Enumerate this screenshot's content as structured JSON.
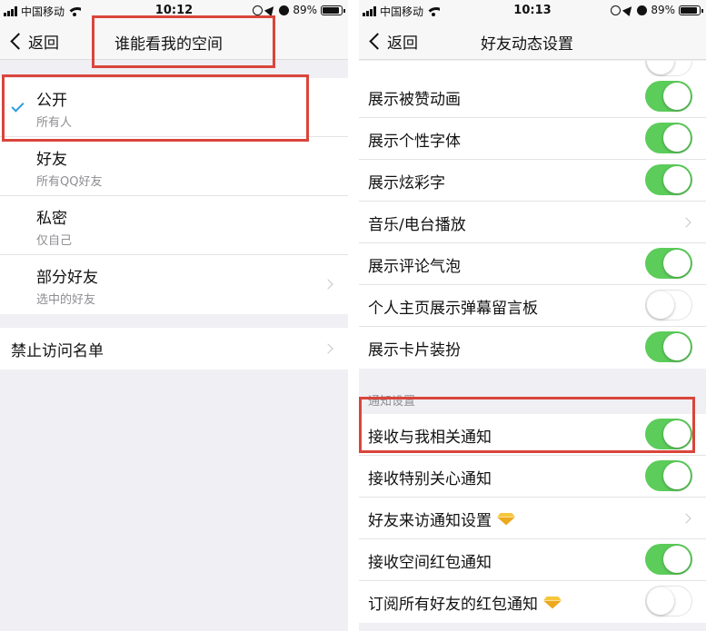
{
  "left_screen": {
    "status": {
      "carrier": "中国移动",
      "time": "10:12",
      "battery": "89%",
      "battery_level": 0.89
    },
    "nav": {
      "back_label": "返回",
      "title": "谁能看我的空间"
    },
    "options": [
      {
        "title": "公开",
        "subtitle": "所有人",
        "selected": true
      },
      {
        "title": "好友",
        "subtitle": "所有QQ好友",
        "selected": false
      },
      {
        "title": "私密",
        "subtitle": "仅自己",
        "selected": false
      },
      {
        "title": "部分好友",
        "subtitle": "选中的好友",
        "selected": false,
        "disclosure": true
      }
    ],
    "blocklist_label": "禁止访问名单"
  },
  "right_screen": {
    "status": {
      "carrier": "中国移动",
      "time": "10:13",
      "battery": "89%",
      "battery_level": 0.89
    },
    "nav": {
      "back_label": "返回",
      "title": "好友动态设置"
    },
    "rows": [
      {
        "label": "展示被赞动画",
        "control": "toggle",
        "on": true
      },
      {
        "label": "展示个性字体",
        "control": "toggle",
        "on": true
      },
      {
        "label": "展示炫彩字",
        "control": "toggle",
        "on": true
      },
      {
        "label": "音乐/电台播放",
        "control": "disclosure"
      },
      {
        "label": "展示评论气泡",
        "control": "toggle",
        "on": true
      },
      {
        "label": "个人主页展示弹幕留言板",
        "control": "toggle",
        "on": false
      },
      {
        "label": "展示卡片装扮",
        "control": "toggle",
        "on": true
      }
    ],
    "notify_section_header": "通知设置",
    "notify_rows": [
      {
        "label": "接收与我相关通知",
        "control": "toggle",
        "on": true
      },
      {
        "label": "接收特别关心通知",
        "control": "toggle",
        "on": true
      },
      {
        "label": "好友来访通知设置",
        "control": "disclosure",
        "badge": "diamond-icon"
      },
      {
        "label": "接收空间红包通知",
        "control": "toggle",
        "on": true
      },
      {
        "label": "订阅所有好友的红包通知",
        "control": "toggle",
        "on": false,
        "badge": "diamond-icon"
      }
    ]
  },
  "colors": {
    "toggle_on": "#5ccc5a",
    "checkmark": "#2a9de0",
    "highlight_box": "#d9453b"
  }
}
